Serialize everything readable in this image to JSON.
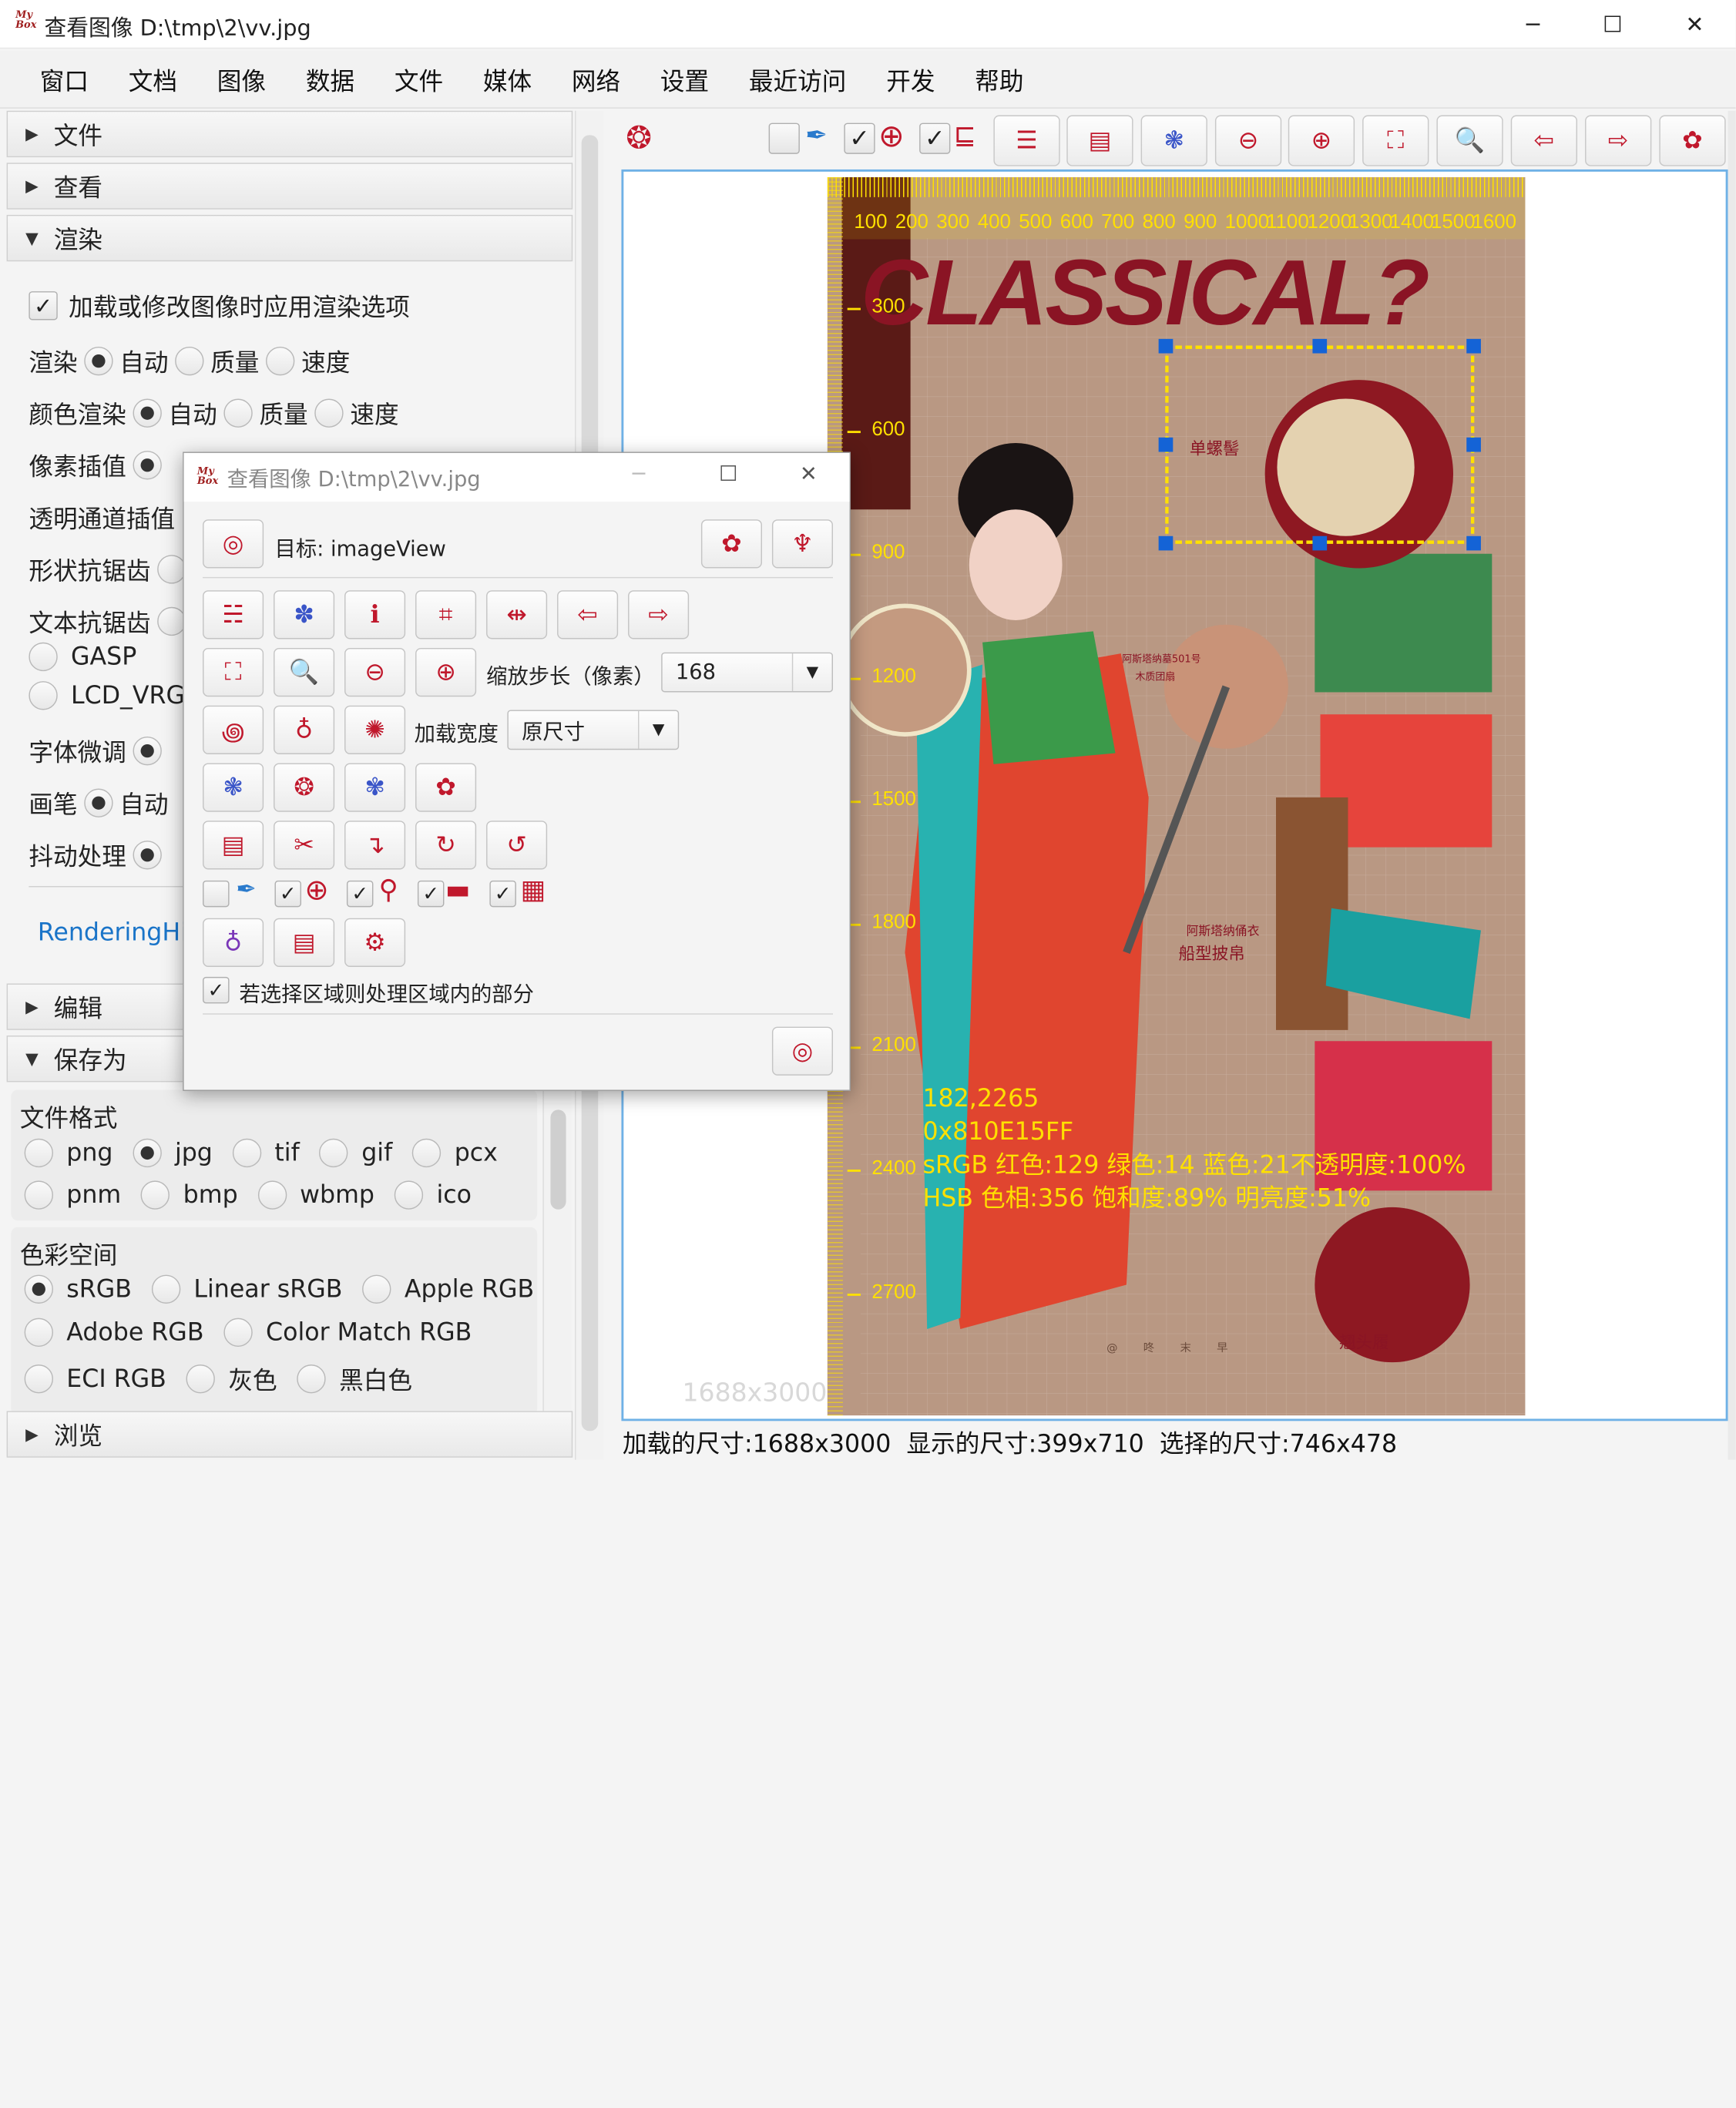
{
  "window": {
    "title": "查看图像 D:\\tmp\\2\\vv.jpg",
    "logo_line1": "My",
    "logo_line2": "Box"
  },
  "window_controls": {
    "minimize": "─",
    "maximize": "☐",
    "close": "✕"
  },
  "menu": [
    "窗口",
    "文档",
    "图像",
    "数据",
    "文件",
    "媒体",
    "网络",
    "设置",
    "最近访问",
    "开发",
    "帮助"
  ],
  "left": {
    "sections": {
      "file": "文件",
      "view": "查看",
      "render": "渲染",
      "edit": "编辑",
      "saveas": "保存为",
      "browse": "浏览"
    },
    "render": {
      "apply_label": "加载或修改图像时应用渲染选项",
      "rendering": "渲染",
      "color_rendering": "颜色渲染",
      "pixel_interp": "像素插值",
      "alpha_interp": "透明通道插值",
      "shape_aa": "形状抗锯齿",
      "text_aa": "文本抗锯齿",
      "gasp": "GASP",
      "lcd": "LCD_VRGB",
      "font_tune": "字体微调",
      "stroke": "画笔",
      "dither": "抖动处理",
      "auto": "自动",
      "quality": "质量",
      "speed": "速度",
      "hints_link": "RenderingHints"
    },
    "saveas": {
      "format_label": "文件格式",
      "formats": [
        "png",
        "jpg",
        "tif",
        "gif",
        "pcx",
        "pnm",
        "bmp",
        "wbmp",
        "ico"
      ],
      "selected_format": "jpg",
      "colorspace_label": "色彩空间",
      "colorspaces": [
        "sRGB",
        "Linear sRGB",
        "Apple RGB",
        "Adobe RGB",
        "Color Match RGB",
        "ECI RGB",
        "灰色",
        "黑白色"
      ],
      "selected_colorspace": "sRGB"
    }
  },
  "toolbar_icons": [
    "pick-color",
    "coordinate",
    "ruler",
    "horizontal",
    "paper",
    "cut",
    "zoom-out",
    "zoom-in",
    "fit",
    "actual-size",
    "previous",
    "next",
    "menu"
  ],
  "image": {
    "size_label": "1688x3000",
    "ruler_x": [
      "100",
      "200",
      "300",
      "400",
      "500",
      "600",
      "700",
      "800",
      "900",
      "1000",
      "1100",
      "1200",
      "1300",
      "1400",
      "1500",
      "1600"
    ],
    "ruler_y": [
      "300",
      "600",
      "900",
      "1200",
      "1500",
      "1800",
      "2100",
      "2400",
      "2700"
    ],
    "poster_title": "CLASSICAL?",
    "labels": {
      "l1": "单螺髻",
      "l2": "阿斯塔纳墓501号",
      "l3": "木质团扇",
      "l4": "阿斯塔纳俑衣",
      "l5": "船型披帛",
      "l6": "翘头履",
      "l7": "@ 咚 末 早"
    },
    "pixel_info": {
      "coords": "182,2265",
      "hex": "0x810E15FF",
      "srgb": "sRGB  红色:129 绿色:14 蓝色:21不透明度:100%",
      "hsb": "HSB  色相:356 饱和度:89% 明亮度:51%"
    }
  },
  "status": {
    "loaded": "加载的尺寸:1688x3000",
    "shown": "显示的尺寸:399x710",
    "selected": "选择的尺寸:746x478"
  },
  "dialog": {
    "title": "查看图像 D:\\tmp\\2\\vv.jpg",
    "target": "目标: imageView",
    "zoom_step_label": "缩放步长（像素）",
    "zoom_step_value": "168",
    "load_width_label": "加载宽度",
    "load_width_value": "原尺寸",
    "process_region_label": "若选择区域则处理区域内的部分"
  },
  "colors": {
    "accent": "#c0182c",
    "ruler": "#ffe000",
    "selection": "#ffe000",
    "handle": "#1463d6"
  }
}
